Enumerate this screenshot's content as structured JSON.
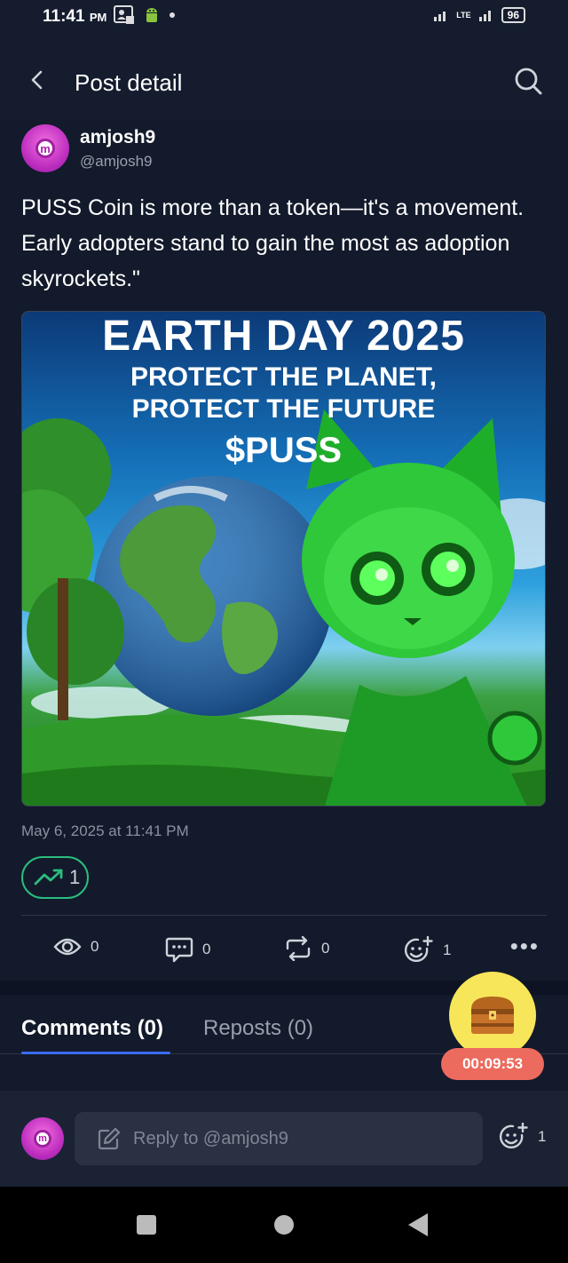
{
  "status_bar": {
    "time": "11:41",
    "ampm": "PM",
    "network": "LTE",
    "battery": "96"
  },
  "header": {
    "title": "Post detail"
  },
  "post": {
    "username": "amjosh9",
    "handle": "@amjosh9",
    "text": "PUSS Coin is more than a token—it's a movement. Early adopters stand to gain the most as adoption skyrockets.\"",
    "image": {
      "headline": "EARTH DAY 2025",
      "subline_1": "PROTECT THE PLANET,",
      "subline_2": "PROTECT THE FUTURE",
      "ticker": "$PUSS"
    },
    "timestamp": "May 6, 2025 at 11:41 PM",
    "trend_count": "1",
    "stats": {
      "views": "0",
      "comments": "0",
      "reposts": "0",
      "reactions": "1"
    }
  },
  "tabs": {
    "comments": "Comments (0)",
    "reposts": "Reposts (0)"
  },
  "reward": {
    "timer": "00:09:53"
  },
  "reply": {
    "placeholder": "Reply to @amjosh9",
    "reaction_count": "1"
  },
  "colors": {
    "background": "#121a2b",
    "accent_blue": "#3b6cf0",
    "trend_green": "#2bbd7e",
    "timer_red": "#ec6b5e",
    "chest_yellow": "#f8e65a"
  }
}
